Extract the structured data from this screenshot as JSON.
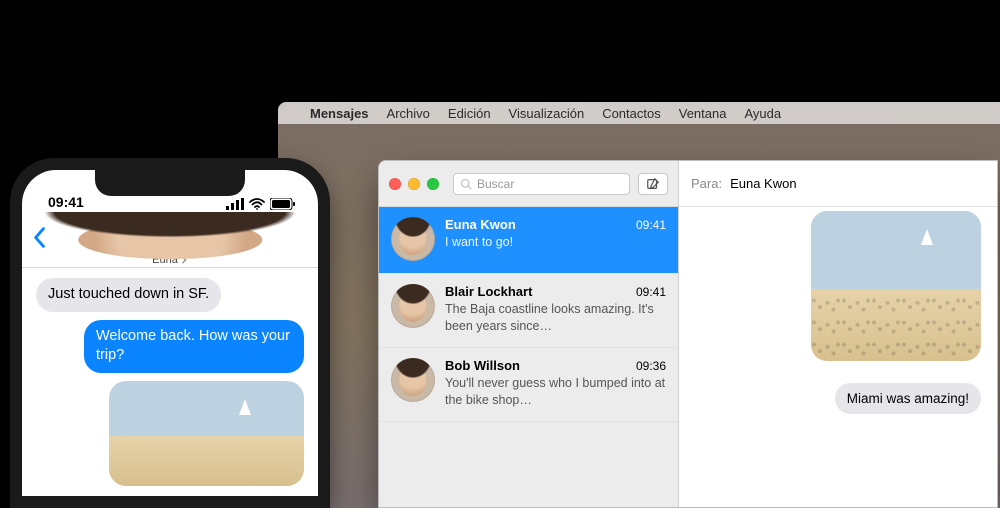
{
  "iphone": {
    "time": "09:41",
    "contact_name": "Euna",
    "bubble_in": "Just touched down in SF.",
    "bubble_out": "Welcome back. How was your trip?"
  },
  "mac": {
    "menubar": {
      "app": "Mensajes",
      "items": [
        "Archivo",
        "Edición",
        "Visualización",
        "Contactos",
        "Ventana",
        "Ayuda"
      ]
    },
    "search_placeholder": "Buscar",
    "to_label": "Para:",
    "to_value": "Euna Kwon",
    "conversations": [
      {
        "name": "Euna Kwon",
        "time": "09:41",
        "preview": "I want to go!",
        "selected": true
      },
      {
        "name": "Blair Lockhart",
        "time": "09:41",
        "preview": "The Baja coastline looks amazing. It's been years since…",
        "selected": false
      },
      {
        "name": "Bob Willson",
        "time": "09:36",
        "preview": "You'll never guess who I bumped into at the bike shop…",
        "selected": false
      }
    ],
    "chat_bubble": "Miami was amazing!"
  }
}
